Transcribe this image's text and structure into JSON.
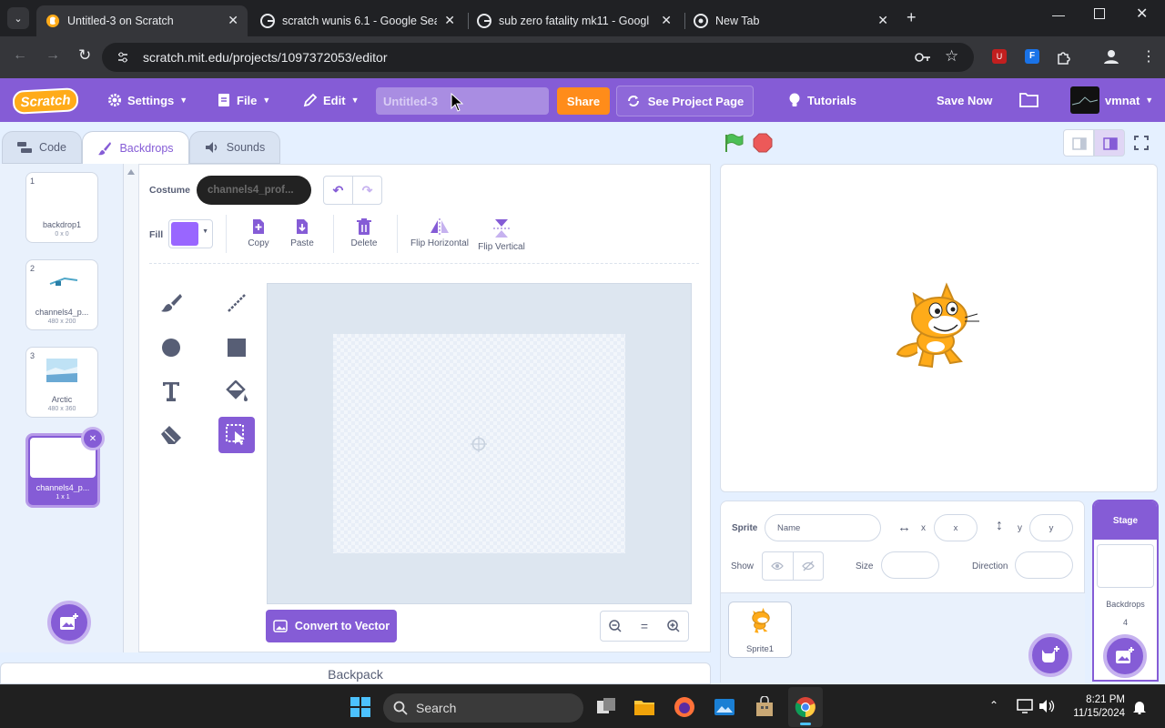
{
  "browser": {
    "tabs": [
      {
        "label": "Untitled-3 on Scratch",
        "active": true
      },
      {
        "label": "scratch wunis 6.1 - Google Sea",
        "active": false
      },
      {
        "label": "sub zero fatality mk11 - Googl",
        "active": false
      },
      {
        "label": "New Tab",
        "active": false
      }
    ],
    "url": "scratch.mit.edu/projects/1097372053/editor"
  },
  "menubar": {
    "logo": "Scratch",
    "settings": "Settings",
    "file": "File",
    "edit": "Edit",
    "project_title": "Untitled-3",
    "share": "Share",
    "see_project": "See Project Page",
    "tutorials": "Tutorials",
    "save_now": "Save Now",
    "username": "vmnat"
  },
  "editor_tabs": {
    "code": "Code",
    "backdrops": "Backdrops",
    "sounds": "Sounds"
  },
  "costumes": [
    {
      "num": "1",
      "name": "backdrop1",
      "size": "0 x 0"
    },
    {
      "num": "2",
      "name": "channels4_p...",
      "size": "480 x 200"
    },
    {
      "num": "3",
      "name": "Arctic",
      "size": "480 x 360"
    },
    {
      "num": "4",
      "name": "channels4_p...",
      "size": "1 x 1"
    }
  ],
  "paint": {
    "costume_label": "Costume",
    "costume_name": "channels4_prof...",
    "fill_label": "Fill",
    "fill_color": "#9966ff",
    "copy": "Copy",
    "paste": "Paste",
    "delete": "Delete",
    "flip_h": "Flip Horizontal",
    "flip_v": "Flip Vertical",
    "convert": "Convert to Vector",
    "zoom_reset": "="
  },
  "sprite_info": {
    "sprite_label": "Sprite",
    "name_placeholder": "Name",
    "x_label": "x",
    "x_placeholder": "x",
    "y_label": "y",
    "y_placeholder": "y",
    "show_label": "Show",
    "size_label": "Size",
    "direction_label": "Direction",
    "sprite1": "Sprite1"
  },
  "stage_panel": {
    "title": "Stage",
    "backdrops_label": "Backdrops",
    "backdrops_count": "4"
  },
  "backpack": "Backpack",
  "taskbar": {
    "search": "Search",
    "time": "8:21 PM",
    "date": "11/15/2024"
  },
  "colors": {
    "scratch_purple": "#855cd6",
    "share_orange": "#ff8c1a",
    "green_flag": "#4cbf56",
    "stop_red": "#ec5959"
  }
}
